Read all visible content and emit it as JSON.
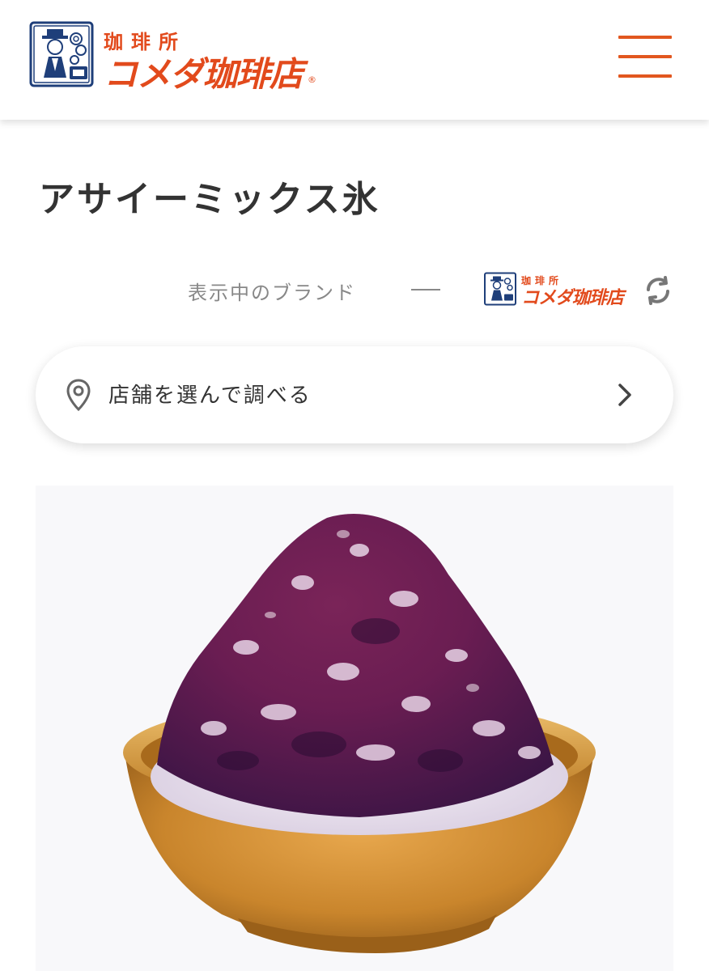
{
  "header": {
    "logo": {
      "small_text": "珈琲所",
      "big_text": "コメダ珈琲店",
      "registered": "®"
    },
    "menu_icon": "hamburger-menu-icon"
  },
  "page": {
    "title": "アサイーミックス氷"
  },
  "brand": {
    "label": "表示中のブランド",
    "logo_small_text": "珈琲所",
    "logo_big_text": "コメダ珈琲店",
    "switch_icon": "refresh-icon"
  },
  "store_selector": {
    "label": "店舗を選んで調べる",
    "pin_icon": "location-pin-icon",
    "chevron_icon": "chevron-right-icon"
  },
  "colors": {
    "brand_orange": "#e24a1c",
    "title_text": "#333333",
    "muted_text": "#888888",
    "logo_navy": "#1f3f7a"
  },
  "product_image": {
    "subject": "acai-mix-shaved-ice"
  }
}
